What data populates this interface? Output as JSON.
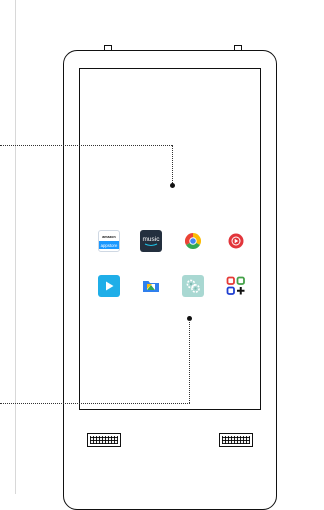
{
  "device": {
    "kind": "kiosk-tablet",
    "colors": {
      "outline": "#111111",
      "leader": "#333333"
    }
  },
  "apps": [
    {
      "name": "amazon-appstore",
      "icon": "amazon-appstore-icon",
      "brand_text": "amazon",
      "label_text": "appstore",
      "color": "#1a98ff"
    },
    {
      "name": "amazon-music",
      "icon": "amazon-music-icon",
      "label_text": "music",
      "color": "#232f3e"
    },
    {
      "name": "chrome",
      "icon": "chrome-icon",
      "color": "#db4437"
    },
    {
      "name": "music-player",
      "icon": "music-player-icon",
      "color": "#e2353b"
    },
    {
      "name": "play-store",
      "icon": "play-icon",
      "color": "#1faee8"
    },
    {
      "name": "files",
      "icon": "files-icon",
      "color": "#2f80ed"
    },
    {
      "name": "settings-app",
      "icon": "gear-app-icon",
      "color": "#a9d8d2"
    },
    {
      "name": "add-app",
      "icon": "add-app-icon",
      "color": "#1f3fd1"
    }
  ]
}
